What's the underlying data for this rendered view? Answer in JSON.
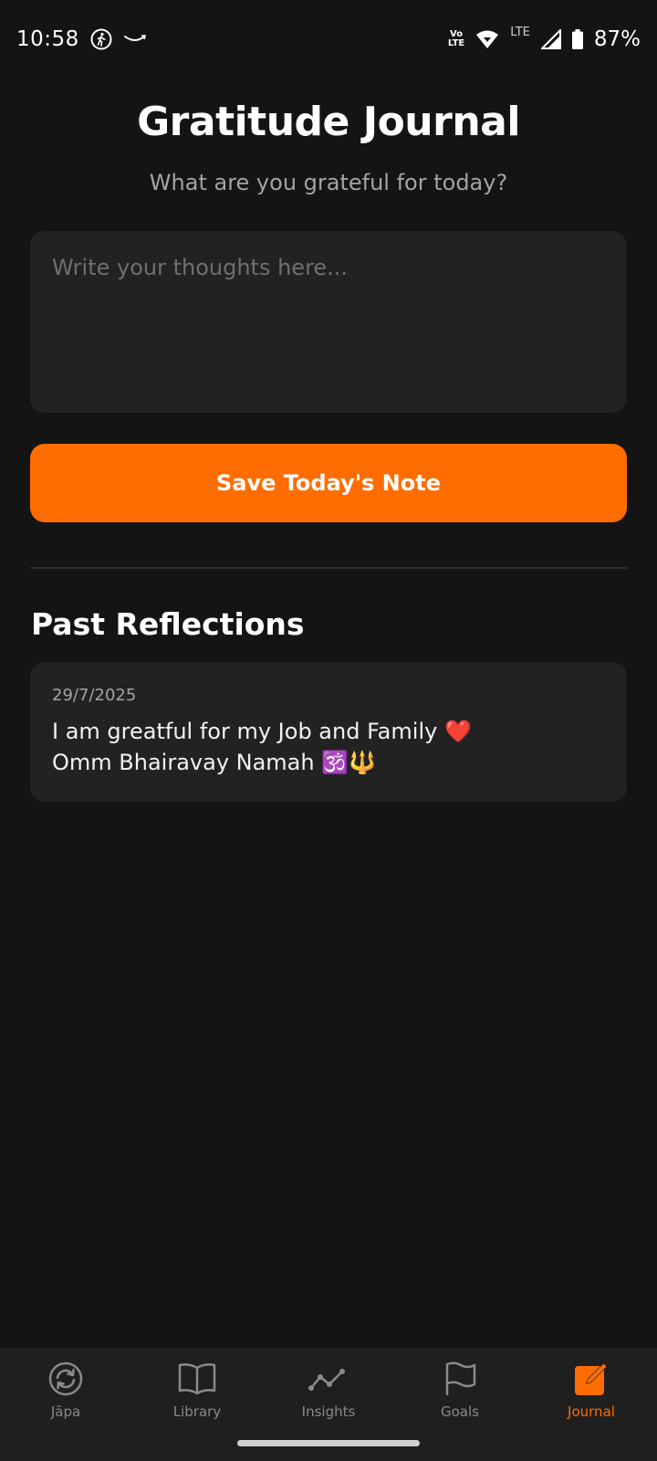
{
  "status_bar": {
    "time": "10:58",
    "volte": "Vo\nLTE",
    "lte": "LTE",
    "battery_percent": "87%"
  },
  "header": {
    "title": "Gratitude Journal",
    "subtitle": "What are you grateful for today?"
  },
  "entry": {
    "placeholder": "Write your thoughts here...",
    "value": "",
    "save_label": "Save Today's Note"
  },
  "past": {
    "title": "Past Reflections",
    "items": [
      {
        "date": "29/7/2025",
        "text": "I am greatful for my Job and Family ❤️\nOmm Bhairavay Namah 🕉️🔱"
      }
    ]
  },
  "nav": {
    "items": [
      {
        "label": "Jāpa",
        "icon": "japa-cycle-icon",
        "active": false
      },
      {
        "label": "Library",
        "icon": "book-icon",
        "active": false
      },
      {
        "label": "Insights",
        "icon": "line-chart-icon",
        "active": false
      },
      {
        "label": "Goals",
        "icon": "flag-icon",
        "active": false
      },
      {
        "label": "Journal",
        "icon": "edit-note-icon",
        "active": true
      }
    ]
  },
  "colors": {
    "background": "#141414",
    "surface": "#222222",
    "accent": "#ff6d00",
    "muted_text": "#a3a3a3"
  }
}
